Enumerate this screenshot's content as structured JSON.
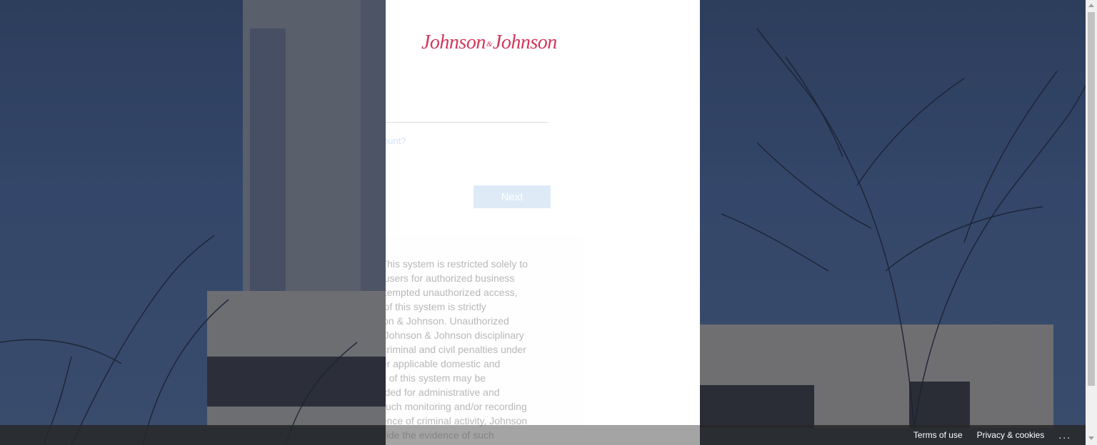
{
  "brand": {
    "logo_left": "Johnson",
    "logo_amp": "&",
    "logo_right": "Johnson",
    "logo_color": "#d3375a"
  },
  "signin": {
    "account_link": "ount?",
    "next_label": "Next"
  },
  "notice_lines": [
    ": This system is restricted solely to",
    "n users for authorized business",
    " attempted unauthorized access,",
    "n of this system is strictly",
    "lson & Johnson. Unauthorized",
    "o Johnson & Johnson disciplinary",
    "r criminal and civil penalties under",
    "her applicable domestic and",
    "se of this system may be",
    "orded for administrative and",
    "l such monitoring and/or recording",
    "dence of criminal activity, Johnson",
    "ovide the evidence of such"
  ],
  "footer": {
    "terms_label": "Terms of use",
    "privacy_label": "Privacy & cookies",
    "more_label": "..."
  },
  "icons": {
    "more": "more-options-icon",
    "scroll_up": "scroll-up-arrow-icon",
    "scroll_down": "scroll-down-arrow-icon"
  },
  "colors": {
    "next_button_bg": "#deebf7",
    "link_color": "#cfe3f6",
    "background_tint": "#2d3d5c"
  }
}
